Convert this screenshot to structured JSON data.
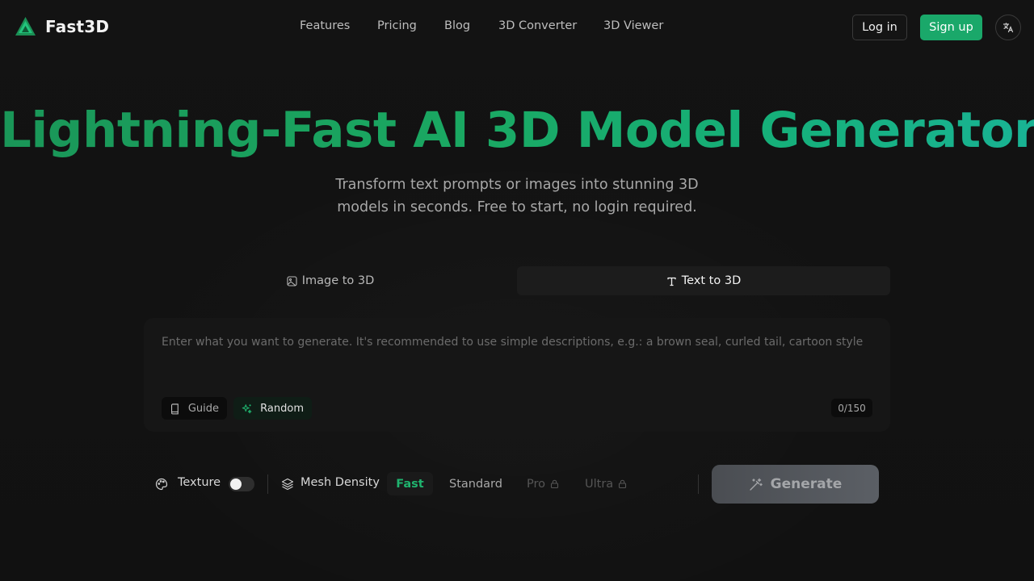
{
  "brand": {
    "name": "Fast3D",
    "accent": "#1aa86a"
  },
  "nav": {
    "items": [
      {
        "label": "Features"
      },
      {
        "label": "Pricing"
      },
      {
        "label": "Blog"
      },
      {
        "label": "3D Converter"
      },
      {
        "label": "3D Viewer"
      }
    ]
  },
  "header": {
    "login_label": "Log in",
    "signup_label": "Sign up",
    "language_icon": "translate-icon"
  },
  "hero": {
    "title": "Lightning-Fast AI 3D Model Generator",
    "subtitle": "Transform text prompts or images into stunning 3D models in seconds. Free to start, no login required."
  },
  "tabs": [
    {
      "label": "Image to 3D",
      "icon": "image-icon",
      "active": false
    },
    {
      "label": "Text to 3D",
      "icon": "text-icon",
      "active": true
    }
  ],
  "prompt": {
    "value": "",
    "placeholder": "Enter what you want to generate. It's recommended to use simple descriptions, e.g.: a brown seal, curled tail, cartoon style",
    "guide_label": "Guide",
    "random_label": "Random",
    "counter": "0/150"
  },
  "options": {
    "texture_label": "Texture",
    "texture_enabled": false,
    "mesh_density_label": "Mesh Density",
    "density_options": [
      {
        "label": "Fast",
        "selected": true,
        "locked": false
      },
      {
        "label": "Standard",
        "selected": false,
        "locked": false
      },
      {
        "label": "Pro",
        "selected": false,
        "locked": true
      },
      {
        "label": "Ultra",
        "selected": false,
        "locked": true
      }
    ],
    "generate_label": "Generate"
  }
}
